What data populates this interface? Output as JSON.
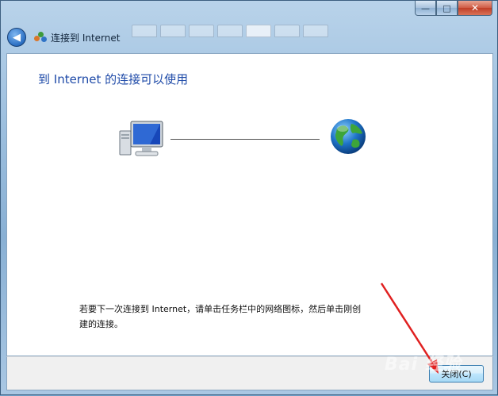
{
  "window": {
    "title": "连接到 Internet",
    "minimize_glyph": "—",
    "maximize_glyph": "□",
    "close_glyph": "✕"
  },
  "navigation": {
    "back_glyph": "◀",
    "icon": "network-connection-icon"
  },
  "main": {
    "heading": "到 Internet 的连接可以使用",
    "left_icon": "computer-icon",
    "right_icon": "globe-icon",
    "description": "若要下一次连接到 Internet，请单击任务栏中的网络图标，然后单击刚创建的连接。"
  },
  "footer": {
    "close_button_label": "关闭(C)"
  },
  "overlay": {
    "annotation": "red-arrow-pointing-to-close-button",
    "watermark": "Bai 经验"
  },
  "colors": {
    "heading": "#1e4aa8",
    "arrow": "#e02020",
    "accent_button_border": "#3c7fb1"
  }
}
